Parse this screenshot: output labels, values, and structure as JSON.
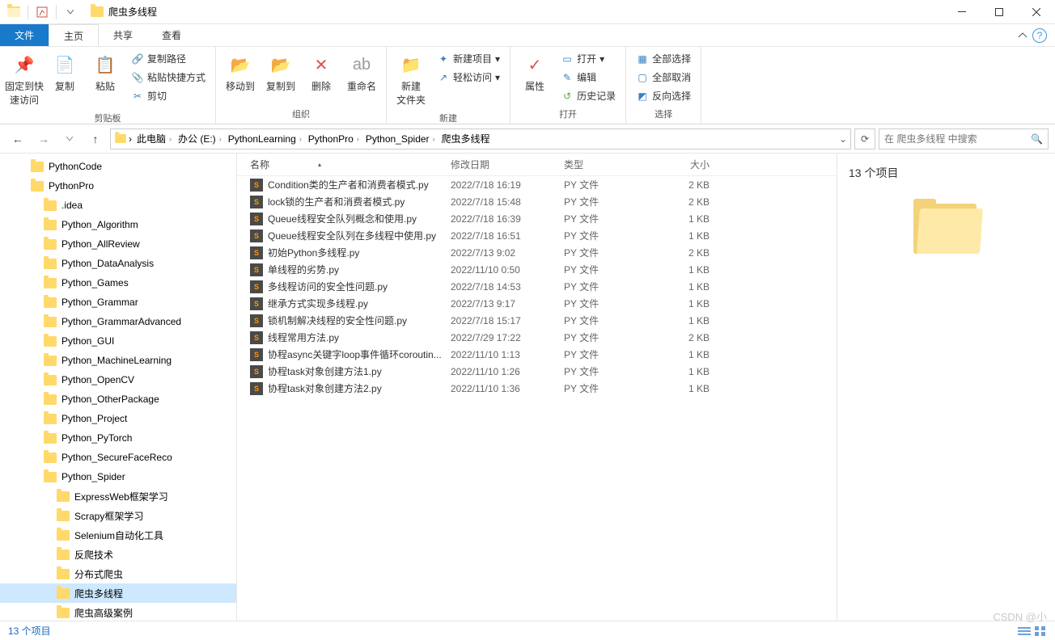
{
  "window": {
    "title": "爬虫多线程"
  },
  "tabs": {
    "file": "文件",
    "home": "主页",
    "share": "共享",
    "view": "查看"
  },
  "ribbon": {
    "pin": "固定到快\n速访问",
    "copy": "复制",
    "paste": "粘贴",
    "copy_path": "复制路径",
    "paste_shortcut": "粘贴快捷方式",
    "cut": "剪切",
    "clip_group": "剪贴板",
    "move_to": "移动到",
    "copy_to": "复制到",
    "delete": "删除",
    "rename": "重命名",
    "org_group": "组织",
    "new_folder": "新建\n文件夹",
    "new_item": "新建项目",
    "easy_access": "轻松访问",
    "new_group": "新建",
    "properties": "属性",
    "open": "打开",
    "edit": "编辑",
    "history": "历史记录",
    "open_group": "打开",
    "select_all": "全部选择",
    "select_none": "全部取消",
    "invert": "反向选择",
    "select_group": "选择"
  },
  "breadcrumb": [
    "此电脑",
    "办公 (E:)",
    "PythonLearning",
    "PythonPro",
    "Python_Spider",
    "爬虫多线程"
  ],
  "search": {
    "placeholder": "在 爬虫多线程 中搜索"
  },
  "tree": [
    {
      "lv": 1,
      "label": "PythonCode"
    },
    {
      "lv": 1,
      "label": "PythonPro"
    },
    {
      "lv": 2,
      "label": ".idea"
    },
    {
      "lv": 2,
      "label": "Python_Algorithm"
    },
    {
      "lv": 2,
      "label": "Python_AllReview"
    },
    {
      "lv": 2,
      "label": "Python_DataAnalysis"
    },
    {
      "lv": 2,
      "label": "Python_Games"
    },
    {
      "lv": 2,
      "label": "Python_Grammar"
    },
    {
      "lv": 2,
      "label": "Python_GrammarAdvanced"
    },
    {
      "lv": 2,
      "label": "Python_GUI"
    },
    {
      "lv": 2,
      "label": "Python_MachineLearning"
    },
    {
      "lv": 2,
      "label": "Python_OpenCV"
    },
    {
      "lv": 2,
      "label": "Python_OtherPackage"
    },
    {
      "lv": 2,
      "label": "Python_Project"
    },
    {
      "lv": 2,
      "label": "Python_PyTorch"
    },
    {
      "lv": 2,
      "label": "Python_SecureFaceReco"
    },
    {
      "lv": 2,
      "label": "Python_Spider"
    },
    {
      "lv": 3,
      "label": "ExpressWeb框架学习"
    },
    {
      "lv": 3,
      "label": "Scrapy框架学习"
    },
    {
      "lv": 3,
      "label": "Selenium自动化工具"
    },
    {
      "lv": 3,
      "label": "反爬技术"
    },
    {
      "lv": 3,
      "label": "分布式爬虫"
    },
    {
      "lv": 3,
      "label": "爬虫多线程",
      "sel": true
    },
    {
      "lv": 3,
      "label": "爬虫高级案例"
    }
  ],
  "columns": {
    "name": "名称",
    "date": "修改日期",
    "type": "类型",
    "size": "大小"
  },
  "files": [
    {
      "name": "Condition类的生产者和消费者模式.py",
      "date": "2022/7/18 16:19",
      "type": "PY 文件",
      "size": "2 KB"
    },
    {
      "name": "lock锁的生产者和消费者模式.py",
      "date": "2022/7/18 15:48",
      "type": "PY 文件",
      "size": "2 KB"
    },
    {
      "name": "Queue线程安全队列概念和使用.py",
      "date": "2022/7/18 16:39",
      "type": "PY 文件",
      "size": "1 KB"
    },
    {
      "name": "Queue线程安全队列在多线程中使用.py",
      "date": "2022/7/18 16:51",
      "type": "PY 文件",
      "size": "1 KB"
    },
    {
      "name": "初始Python多线程.py",
      "date": "2022/7/13 9:02",
      "type": "PY 文件",
      "size": "2 KB"
    },
    {
      "name": "单线程的劣势.py",
      "date": "2022/11/10 0:50",
      "type": "PY 文件",
      "size": "1 KB"
    },
    {
      "name": "多线程访问的安全性问题.py",
      "date": "2022/7/18 14:53",
      "type": "PY 文件",
      "size": "1 KB"
    },
    {
      "name": "继承方式实现多线程.py",
      "date": "2022/7/13 9:17",
      "type": "PY 文件",
      "size": "1 KB"
    },
    {
      "name": "锁机制解决线程的安全性问题.py",
      "date": "2022/7/18 15:17",
      "type": "PY 文件",
      "size": "1 KB"
    },
    {
      "name": "线程常用方法.py",
      "date": "2022/7/29 17:22",
      "type": "PY 文件",
      "size": "2 KB"
    },
    {
      "name": "协程async关键字loop事件循环coroutin...",
      "date": "2022/11/10 1:13",
      "type": "PY 文件",
      "size": "1 KB"
    },
    {
      "name": "协程task对象创建方法1.py",
      "date": "2022/11/10 1:26",
      "type": "PY 文件",
      "size": "1 KB"
    },
    {
      "name": "协程task对象创建方法2.py",
      "date": "2022/11/10 1:36",
      "type": "PY 文件",
      "size": "1 KB"
    }
  ],
  "preview": {
    "count": "13 个项目"
  },
  "status": {
    "text": "13 个项目"
  },
  "watermark": "CSDN @小"
}
